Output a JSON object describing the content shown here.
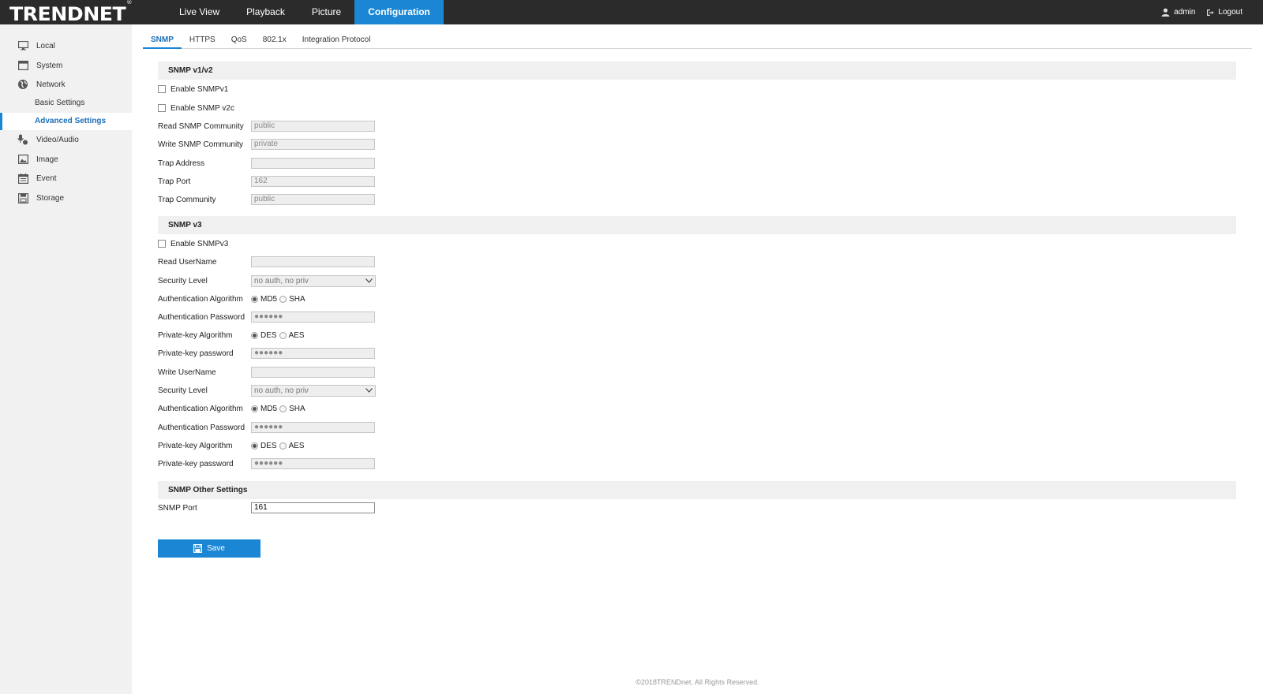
{
  "brand": {
    "logo_text": "TRENDNET",
    "logo_mark": "®"
  },
  "nav": {
    "items": [
      {
        "label": "Live View"
      },
      {
        "label": "Playback"
      },
      {
        "label": "Picture"
      },
      {
        "label": "Configuration",
        "active": true
      }
    ]
  },
  "user": {
    "name": "admin",
    "logout": "Logout"
  },
  "sidebar": {
    "items": [
      {
        "label": "Local",
        "icon": "monitor-icon"
      },
      {
        "label": "System",
        "icon": "system-icon"
      },
      {
        "label": "Network",
        "icon": "globe-icon"
      },
      {
        "label": "Basic Settings",
        "sub": true
      },
      {
        "label": "Advanced Settings",
        "sub": true,
        "active": true
      },
      {
        "label": "Video/Audio",
        "icon": "video-audio-icon"
      },
      {
        "label": "Image",
        "icon": "image-icon"
      },
      {
        "label": "Event",
        "icon": "calendar-icon"
      },
      {
        "label": "Storage",
        "icon": "storage-icon"
      }
    ]
  },
  "tabs": [
    {
      "label": "SNMP",
      "active": true
    },
    {
      "label": "HTTPS"
    },
    {
      "label": "QoS"
    },
    {
      "label": "802.1x"
    },
    {
      "label": "Integration Protocol"
    }
  ],
  "snmp_v12": {
    "heading": "SNMP v1/v2",
    "enable_v1": "Enable SNMPv1",
    "enable_v2c": "Enable SNMP v2c",
    "read_community_label": "Read SNMP Community",
    "read_community_value": "public",
    "write_community_label": "Write SNMP Community",
    "write_community_value": "private",
    "trap_address_label": "Trap Address",
    "trap_address_value": "",
    "trap_port_label": "Trap Port",
    "trap_port_value": "162",
    "trap_community_label": "Trap Community",
    "trap_community_value": "public"
  },
  "snmp_v3": {
    "heading": "SNMP v3",
    "enable_v3": "Enable SNMPv3",
    "read_username_label": "Read UserName",
    "read_username_value": "",
    "read_security_label": "Security Level",
    "read_security_value": "no auth, no priv",
    "read_auth_algo_label": "Authentication Algorithm",
    "read_auth_password_label": "Authentication Password",
    "read_auth_password_value": "●●●●●●",
    "read_priv_algo_label": "Private-key Algorithm",
    "read_priv_password_label": "Private-key password",
    "read_priv_password_value": "●●●●●●",
    "write_username_label": "Write UserName",
    "write_username_value": "",
    "write_security_label": "Security Level",
    "write_security_value": "no auth, no priv",
    "write_auth_algo_label": "Authentication Algorithm",
    "write_auth_password_label": "Authentication Password",
    "write_auth_password_value": "●●●●●●",
    "write_priv_algo_label": "Private-key Algorithm",
    "write_priv_password_label": "Private-key password",
    "write_priv_password_value": "●●●●●●",
    "auth_opt_md5": "MD5",
    "auth_opt_sha": "SHA",
    "priv_opt_des": "DES",
    "priv_opt_aes": "AES"
  },
  "snmp_other": {
    "heading": "SNMP Other Settings",
    "port_label": "SNMP Port",
    "port_value": "161"
  },
  "save_label": "Save",
  "footer": "©2018TRENDnet. All Rights Reserved.",
  "colors": {
    "accent": "#1b87d4",
    "topbar": "#2b2b2b",
    "sidebar": "#f1f1f1"
  }
}
